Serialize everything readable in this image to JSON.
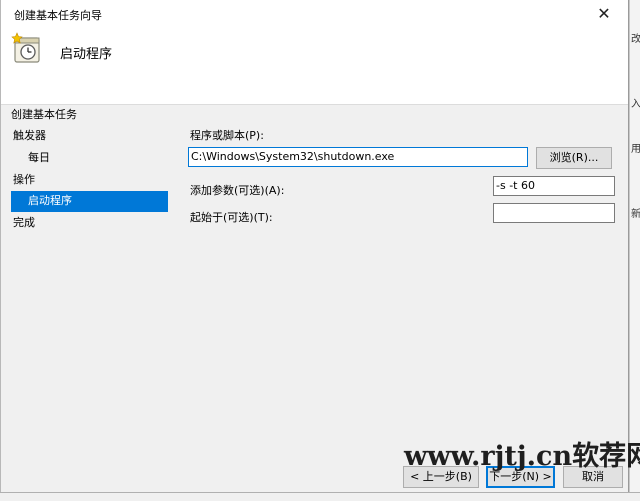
{
  "window": {
    "title": "创建基本任务向导",
    "close_glyph": "✕"
  },
  "header": {
    "title": "启动程序",
    "icon": "task-scheduler-icon"
  },
  "nav": {
    "items": [
      {
        "label": "创建基本任务",
        "selected": false
      },
      {
        "label": "触发器",
        "selected": false
      },
      {
        "label": "每日",
        "selected": false
      },
      {
        "label": "操作",
        "selected": false
      },
      {
        "label": "启动程序",
        "selected": true
      },
      {
        "label": "完成",
        "selected": false
      }
    ]
  },
  "form": {
    "program_label": "程序或脚本(P):",
    "program_value": "C:\\Windows\\System32\\shutdown.exe",
    "browse_label": "浏览(R)...",
    "args_label": "添加参数(可选)(A):",
    "args_value": "-s -t 60",
    "startin_label": "起始于(可选)(T):",
    "startin_value": ""
  },
  "buttons": {
    "back_label": "< 上一步(B)",
    "next_label": "下一步(N) >",
    "cancel_label": "取消"
  },
  "watermark": "www.rjtj.cn软荐网",
  "background_strip": [
    "改",
    "入",
    "用",
    "新"
  ],
  "colors": {
    "selection": "#0078d7",
    "dialog_bg": "#f0f0f0",
    "header_bg": "#ffffff"
  }
}
